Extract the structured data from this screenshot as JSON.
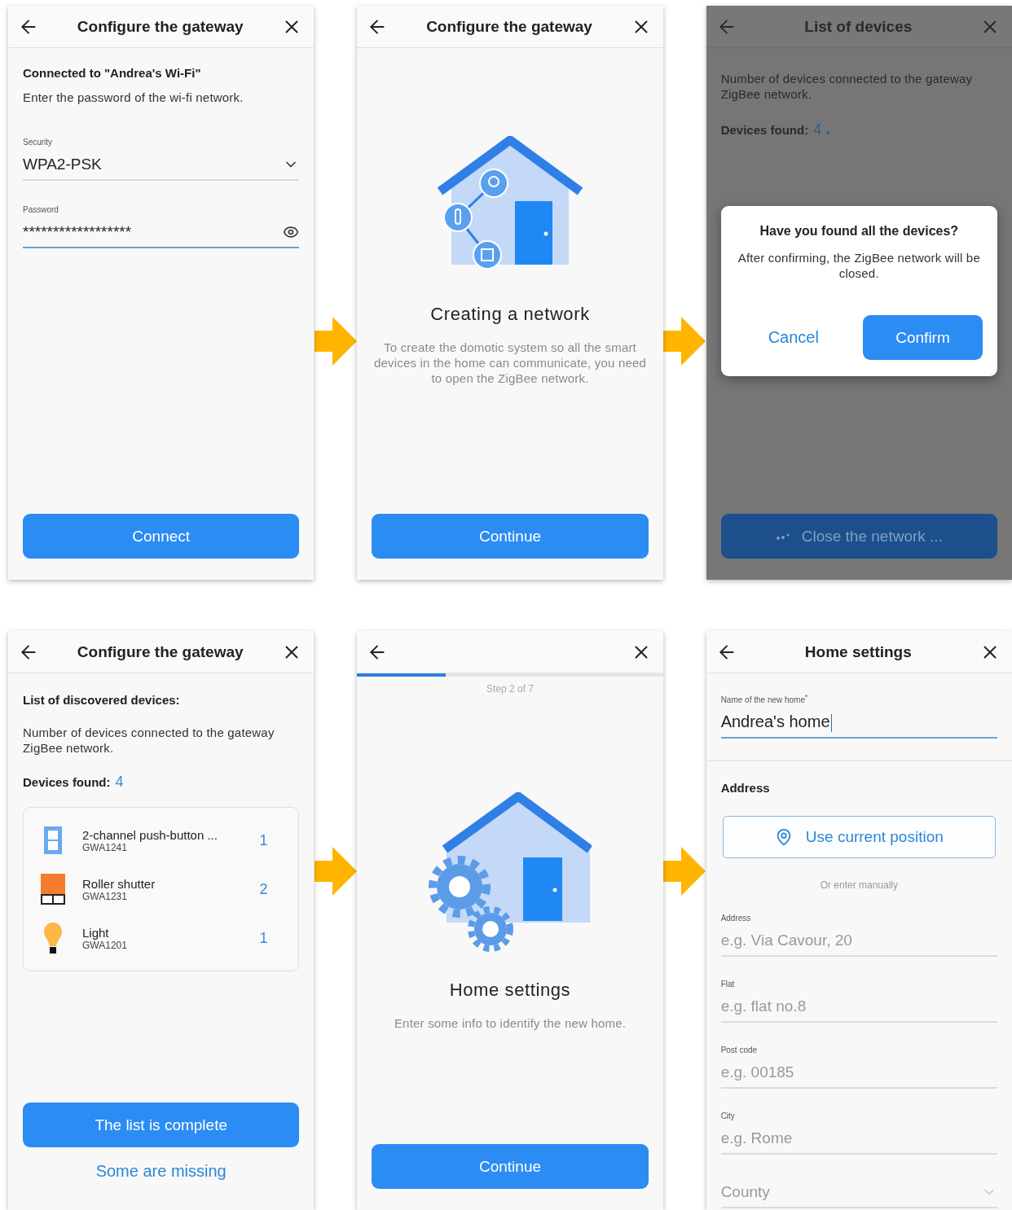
{
  "screens": [
    {
      "kind": "wifi",
      "header": {
        "title": "Configure the gateway"
      },
      "heading": "Connected to \"Andrea's Wi-Fi\"",
      "text": "Enter the password of the wi-fi network.",
      "fields": [
        {
          "kind": "select",
          "label": "Security",
          "value": "WPA2-PSK",
          "focused": false
        },
        {
          "kind": "password",
          "label": "Password",
          "value": "******************",
          "focused": true
        }
      ],
      "button": "Connect"
    },
    {
      "kind": "info",
      "header": {
        "title": "Configure the gateway"
      },
      "illustration": {
        "kind": "network"
      },
      "title": "Creating a network",
      "text": "To create the domotic system so all the smart devices in the home can communicate, you need to open the ZigBee network.",
      "button": "Continue"
    },
    {
      "kind": "dialog",
      "header": {
        "title": "List of devices"
      },
      "text": "Number of devices connected to the gateway ZigBee network.",
      "found_label": "Devices found:",
      "found_count": "4",
      "button": "Close the network ...",
      "dialog": {
        "title": "Have you found all the devices?",
        "text": "After confirming, the ZigBee network will be closed.",
        "cancel": "Cancel",
        "confirm": "Confirm"
      }
    },
    {
      "kind": "devices",
      "header": {
        "title": "Configure the gateway"
      },
      "heading": "List of discovered devices:",
      "text": "Number of devices connected to the gateway ZigBee network.",
      "found_label": "Devices found:",
      "found_count": "4",
      "devices": [
        {
          "kind": "switch",
          "name": "2-channel push-button ...",
          "code": "GWA1241",
          "count": "1"
        },
        {
          "kind": "shutter",
          "name": "Roller shutter",
          "code": "GWA1231",
          "count": "2"
        },
        {
          "kind": "bulb",
          "name": "Light",
          "code": "GWA1201",
          "count": "1"
        }
      ],
      "button": "The list is complete",
      "link": "Some are missing"
    },
    {
      "kind": "info",
      "header": {
        "progress": {
          "level": 0.29
        }
      },
      "step": "Step 2 of 7",
      "illustration": {
        "kind": "gears"
      },
      "title": "Home settings",
      "text": "Enter some info to identify the new home.",
      "button": "Continue"
    },
    {
      "kind": "form",
      "header": {
        "title": "Home settings"
      },
      "fields": [
        {
          "kind": "text",
          "label": "Name of the new home$^{*}$",
          "value": "Andrea's home",
          "focused": true
        }
      ],
      "section": "Address",
      "locate_button": "Use current position",
      "hint": "Or enter manually",
      "address_fields": [
        {
          "kind": "text",
          "label": "Address",
          "placeholder": "e.g. Via Cavour, 20",
          "focused": false
        },
        {
          "kind": "text",
          "label": "Flat",
          "placeholder": "e.g. flat no.8",
          "focused": false
        },
        {
          "kind": "text",
          "label": "Post code",
          "placeholder": "e.g. 00185",
          "focused": false
        },
        {
          "kind": "text",
          "label": "City",
          "placeholder": "e.g. Rome",
          "focused": false
        },
        {
          "kind": "select",
          "placeholder": "County",
          "focused": false
        }
      ]
    }
  ]
}
